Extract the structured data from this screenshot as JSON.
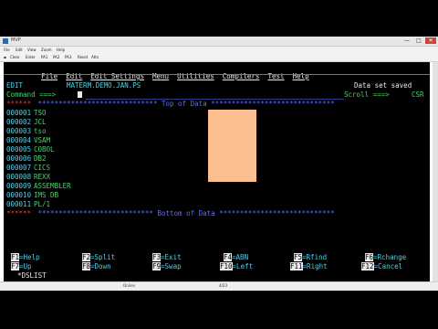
{
  "window": {
    "title": "MVP",
    "minimize": "—",
    "maximize": "□",
    "close": "✕"
  },
  "menubar": {
    "items": [
      "File",
      "Edit",
      "View",
      "Zoom",
      "Help"
    ]
  },
  "toolbar": {
    "items": [
      "Clear",
      "Enter",
      "PA1",
      "PA2",
      "PA3",
      "Reset",
      "Attn"
    ]
  },
  "ispf": {
    "action_bar": [
      "File",
      "Edit",
      "Edit_Settings",
      "Menu",
      "Utilities",
      "Compilers",
      "Test",
      "Help"
    ],
    "mode": "EDIT",
    "dataset": "MATERM.DEMO.JAN.PS",
    "message": "Data set saved",
    "command_label": "Command ===>",
    "scroll_label": "Scroll ===>",
    "scroll_value": "CSR",
    "top_line_prefix": "******",
    "top_line_text": " ***************************** Top of Data ******************************",
    "lines": [
      {
        "num": "000001",
        "text": "TSO"
      },
      {
        "num": "000002",
        "text": "JCL"
      },
      {
        "num": "000003",
        "text": "tso"
      },
      {
        "num": "000004",
        "text": "VSAM"
      },
      {
        "num": "000005",
        "text": "COBOL"
      },
      {
        "num": "000006",
        "text": "DB2"
      },
      {
        "num": "000007",
        "text": "CICS"
      },
      {
        "num": "000008",
        "text": "REXX"
      },
      {
        "num": "000009",
        "text": "ASSEMBLER"
      },
      {
        "num": "000010",
        "text": "IMS DB"
      },
      {
        "num": "000011",
        "text": "PL/1"
      }
    ],
    "bottom_line_prefix": "******",
    "bottom_line_text": " **************************** Bottom of Data ****************************",
    "pfkeys_row1": [
      {
        "key": "F1",
        "label": "=Help"
      },
      {
        "key": "F2",
        "label": "=Split"
      },
      {
        "key": "F3",
        "label": "=Exit"
      },
      {
        "key": "F5",
        "label": "=Rfind"
      },
      {
        "key": "F6",
        "label": "=Rchange"
      },
      {
        "key": "F7",
        "label": "=Up"
      }
    ],
    "pfkeys_row2": [
      {
        "key": "F8",
        "label": "=Down"
      },
      {
        "key": "F9",
        "label": "=Swap"
      },
      {
        "key": "F10",
        "label": "=Left"
      },
      {
        "key": "F11",
        "label": "=Right"
      },
      {
        "key": "F12",
        "label": "=Cancel"
      }
    ],
    "pfkeys_f4": {
      "key": "F4",
      "label": "=ABN"
    },
    "command_hint": "*DSLIST"
  },
  "statusbar": {
    "left": "",
    "mid": "Online",
    "right": "4/23"
  }
}
